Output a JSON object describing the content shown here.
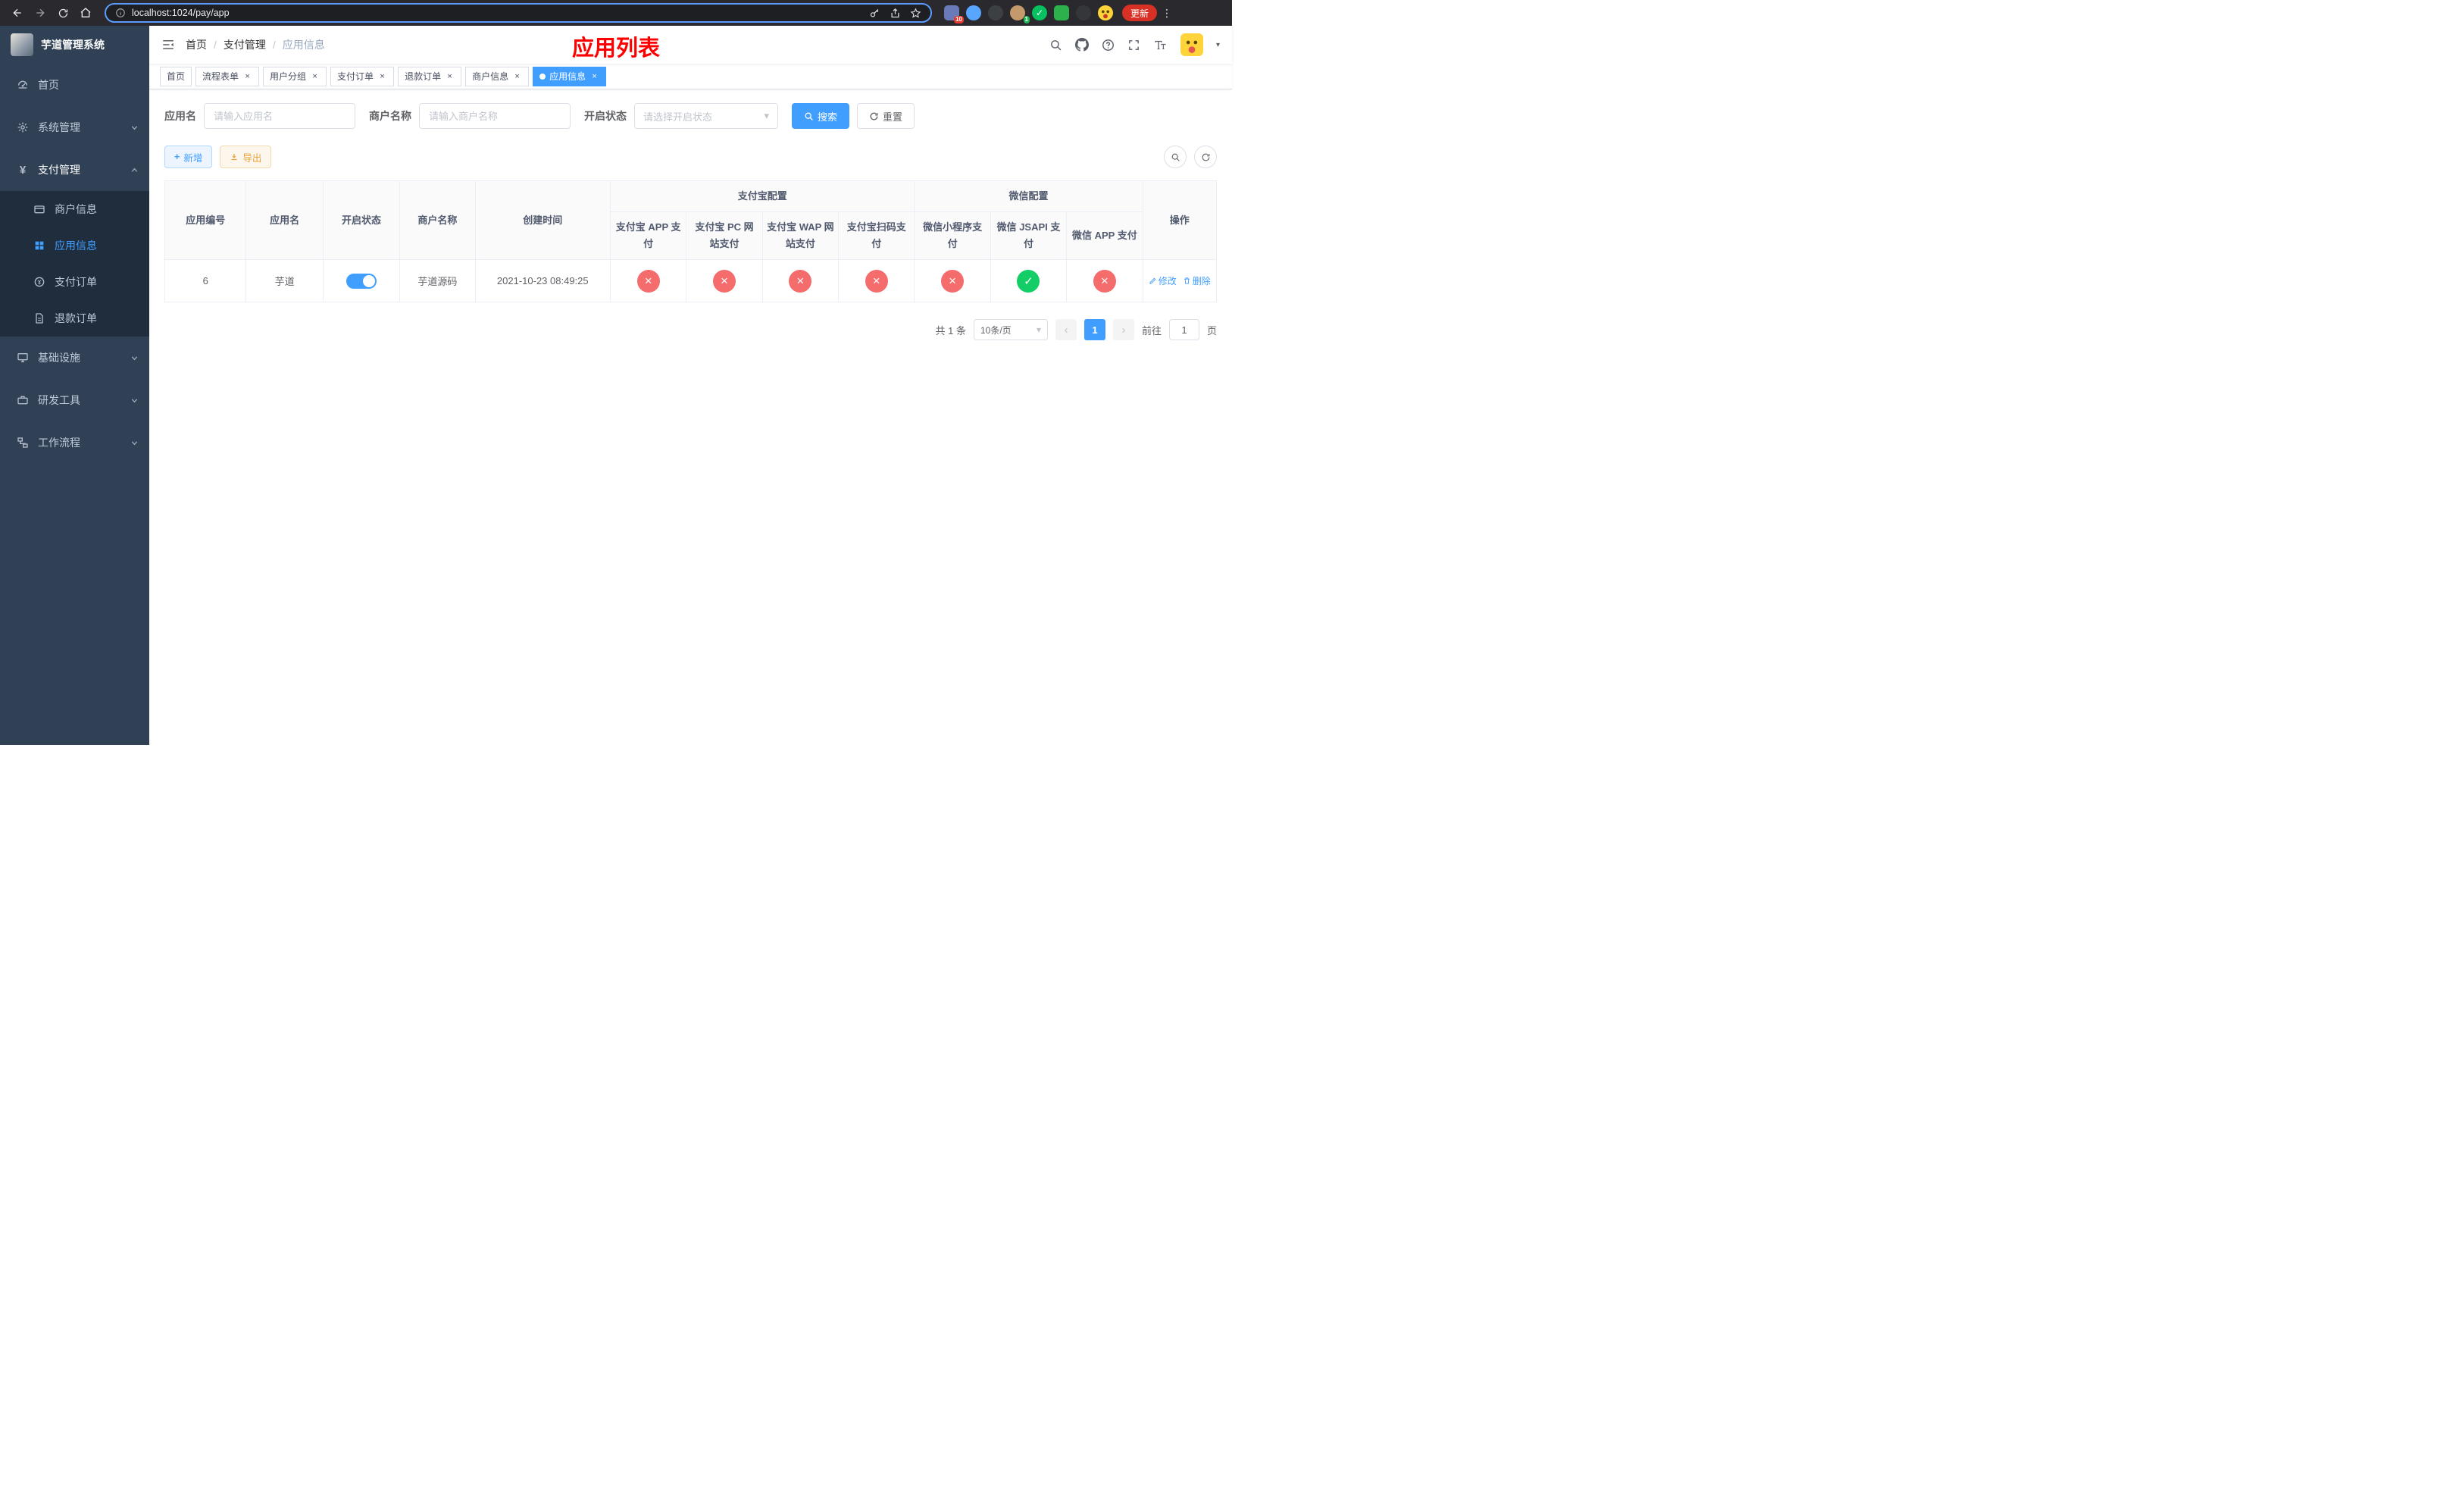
{
  "colors": {
    "accent": "#409eff",
    "danger": "#f56c6c",
    "success": "#13ce66",
    "warning": "#e6a23c",
    "sidebar_bg": "#304156",
    "submenu_bg": "#1f2d3d",
    "title_red": "#ff0000",
    "chrome_bg": "#2a2a2e",
    "update_red": "#d93025"
  },
  "browser": {
    "url": "localhost:1024/pay/app",
    "update_button": "更新",
    "ext_badge_red": "10",
    "ext_badge_green": "1"
  },
  "sidebar": {
    "title": "芋道管理系统",
    "menu": [
      {
        "label": "首页"
      },
      {
        "label": "系统管理"
      },
      {
        "label": "支付管理",
        "children": [
          {
            "label": "商户信息"
          },
          {
            "label": "应用信息",
            "active": true
          },
          {
            "label": "支付订单"
          },
          {
            "label": "退款订单"
          }
        ]
      },
      {
        "label": "基础设施"
      },
      {
        "label": "研发工具"
      },
      {
        "label": "工作流程"
      }
    ]
  },
  "header": {
    "breadcrumb": [
      "首页",
      "支付管理",
      "应用信息"
    ],
    "page_title": "应用列表"
  },
  "tabs": [
    {
      "label": "首页",
      "closable": false
    },
    {
      "label": "流程表单",
      "closable": true
    },
    {
      "label": "用户分组",
      "closable": true
    },
    {
      "label": "支付订单",
      "closable": true
    },
    {
      "label": "退款订单",
      "closable": true
    },
    {
      "label": "商户信息",
      "closable": true
    },
    {
      "label": "应用信息",
      "closable": true,
      "active": true
    }
  ],
  "filters": {
    "app_name_label": "应用名",
    "app_name_placeholder": "请输入应用名",
    "merchant_label": "商户名称",
    "merchant_placeholder": "请输入商户名称",
    "status_label": "开启状态",
    "status_placeholder": "请选择开启状态",
    "search_button": "搜索",
    "reset_button": "重置"
  },
  "toolbar": {
    "add_button": "新增",
    "export_button": "导出"
  },
  "table": {
    "headers": {
      "app_id": "应用编号",
      "app_name": "应用名",
      "status": "开启状态",
      "merchant": "商户名称",
      "created": "创建时间",
      "alipay_group": "支付宝配置",
      "wechat_group": "微信配置",
      "alipay_app": "支付宝 APP 支付",
      "alipay_pc": "支付宝 PC 网站支付",
      "alipay_wap": "支付宝 WAP 网站支付",
      "alipay_qr": "支付宝扫码支付",
      "wechat_mini": "微信小程序支付",
      "wechat_jsapi": "微信 JSAPI 支付",
      "wechat_app": "微信 APP 支付",
      "actions": "操作"
    },
    "rows": [
      {
        "app_id": "6",
        "app_name": "芋道",
        "status_on": true,
        "merchant": "芋道源码",
        "created": "2021-10-23 08:49:25",
        "alipay_app": false,
        "alipay_pc": false,
        "alipay_wap": false,
        "alipay_qr": false,
        "wechat_mini": false,
        "wechat_jsapi": true,
        "wechat_app": false,
        "edit": "修改",
        "delete": "删除"
      }
    ]
  },
  "pagination": {
    "total": "共 1 条",
    "page_size": "10条/页",
    "page": "1",
    "goto_prefix": "前往",
    "goto_value": "1",
    "goto_suffix": "页"
  }
}
